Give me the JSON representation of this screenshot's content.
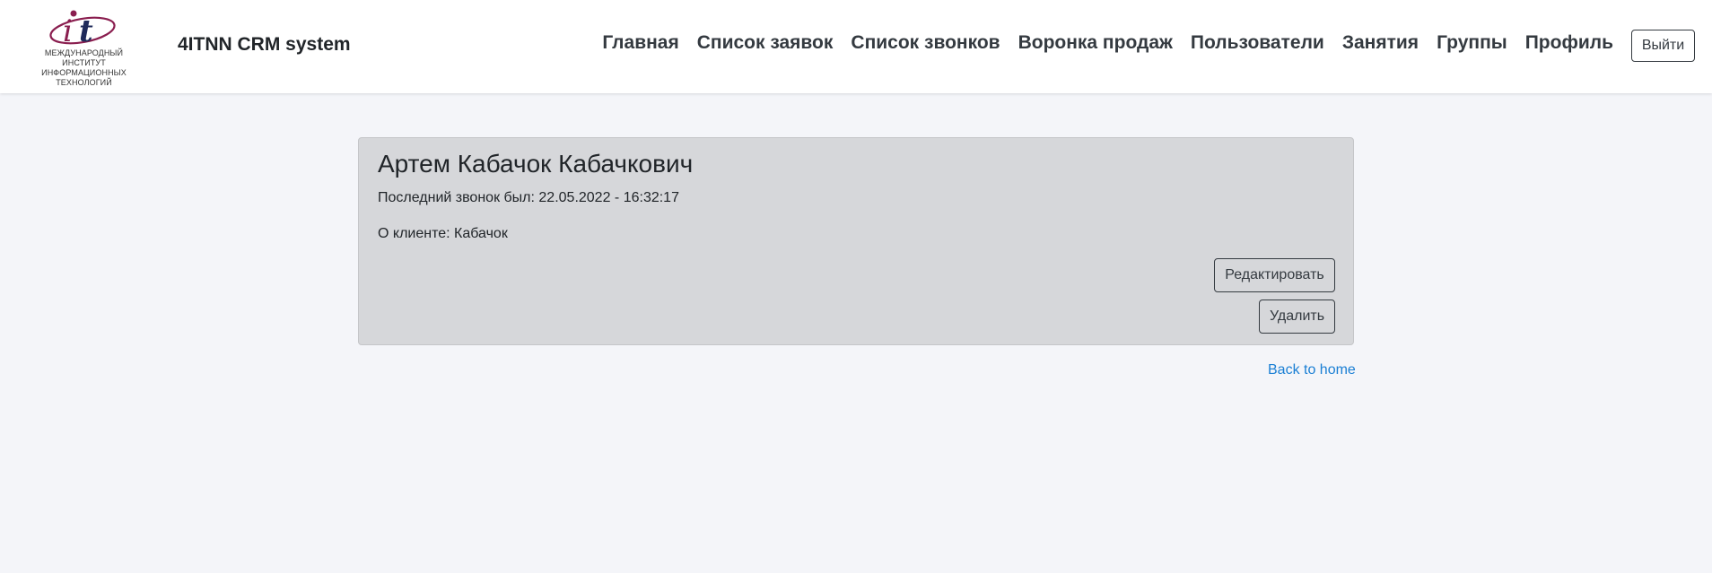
{
  "header": {
    "logo_caption": "МЕЖДУНАРОДНЫЙ ИНСТИТУТ ИНФОРМАЦИОННЫХ ТЕХНОЛОГИЙ",
    "brand": "4ITNN CRM system",
    "nav": [
      {
        "label": "Главная"
      },
      {
        "label": "Список заявок"
      },
      {
        "label": "Список звонков"
      },
      {
        "label": "Воронка продаж"
      },
      {
        "label": "Пользователи"
      },
      {
        "label": "Занятия"
      },
      {
        "label": "Группы"
      },
      {
        "label": "Профиль"
      }
    ],
    "logout_label": "Выйти"
  },
  "card": {
    "client_name": "Артем Кабачок Кабачкович",
    "last_call": "Последний звонок был: 22.05.2022 - 16:32:17",
    "about": "О клиенте: Кабачок",
    "edit_label": "Редактировать",
    "delete_label": "Удалить"
  },
  "back_link": "Back to home",
  "colors": {
    "page_bg": "#f4f5f9",
    "card_bg": "#d6d7da",
    "link": "#1a7fd4",
    "logo_magenta": "#8a1e4f",
    "logo_navy": "#1f2a5a"
  }
}
